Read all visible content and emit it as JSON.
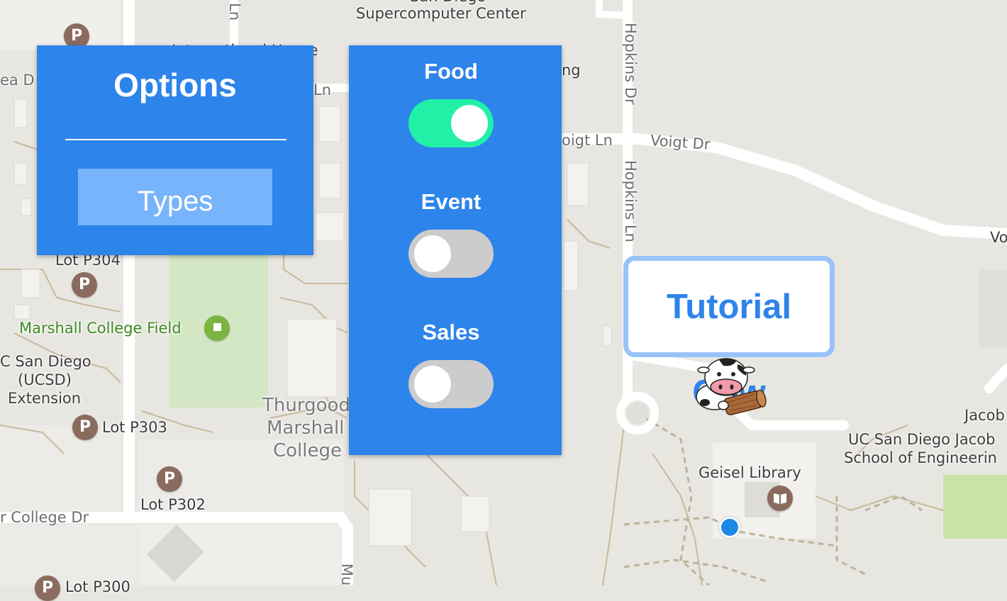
{
  "map": {
    "road_labels": [
      {
        "id": "hopkins-dr",
        "text": "Hopkins Dr"
      },
      {
        "id": "hopkins-ln",
        "text": "Hopkins Ln"
      },
      {
        "id": "voigt-ln",
        "text": "oigt Ln"
      },
      {
        "id": "voigt-dr",
        "text": "Voigt Dr"
      },
      {
        "id": "college-dr",
        "text": "r College Dr"
      },
      {
        "id": "ln-top",
        "text": "Ln"
      },
      {
        "id": "ln-mid",
        "text": "Ln"
      },
      {
        "id": "ea-d",
        "text": "ea D"
      },
      {
        "id": "mu",
        "text": "Mu"
      }
    ],
    "place_labels": [
      {
        "id": "supercomputer",
        "text": "Supercomputer Center"
      },
      {
        "id": "san-diego-top",
        "text": "San Diego"
      },
      {
        "id": "international-house",
        "text": "International House"
      },
      {
        "id": "ng",
        "text": "ng"
      },
      {
        "id": "lot-p304",
        "text": "Lot P304"
      },
      {
        "id": "marshall-field",
        "text": "Marshall College Field"
      },
      {
        "id": "ucsd-ext-1",
        "text": "C San Diego"
      },
      {
        "id": "ucsd-ext-2",
        "text": "(UCSD)"
      },
      {
        "id": "ucsd-ext-3",
        "text": "Extension"
      },
      {
        "id": "lot-p303",
        "text": "Lot P303"
      },
      {
        "id": "lot-p302",
        "text": "Lot P302"
      },
      {
        "id": "lot-p-bottom",
        "text": "Lot P300"
      },
      {
        "id": "thurgood-1",
        "text": "Thurgood"
      },
      {
        "id": "thurgood-2",
        "text": "Marshall"
      },
      {
        "id": "thurgood-3",
        "text": "College"
      },
      {
        "id": "geisel",
        "text": "Geisel Library"
      },
      {
        "id": "jacobs-1",
        "text": "Jacob"
      },
      {
        "id": "jacobs-2",
        "text": "UC San Diego Jacob"
      },
      {
        "id": "jacobs-3",
        "text": "School of Engineerin"
      },
      {
        "id": "vo",
        "text": "Vo"
      }
    ],
    "parking_glyph": "P"
  },
  "options": {
    "title": "Options",
    "types_button": "Types"
  },
  "filters": [
    {
      "label": "Food",
      "enabled": true
    },
    {
      "label": "Event",
      "enabled": false
    },
    {
      "label": "Sales",
      "enabled": false
    }
  ],
  "tooltip": {
    "text": "Tutorial Cow"
  },
  "colors": {
    "panel": "#2d84ea",
    "toggle_on": "#21f0a6",
    "toggle_off": "#cccccc",
    "button": "#77b4fb",
    "tooltip_border": "#98c3f8"
  }
}
